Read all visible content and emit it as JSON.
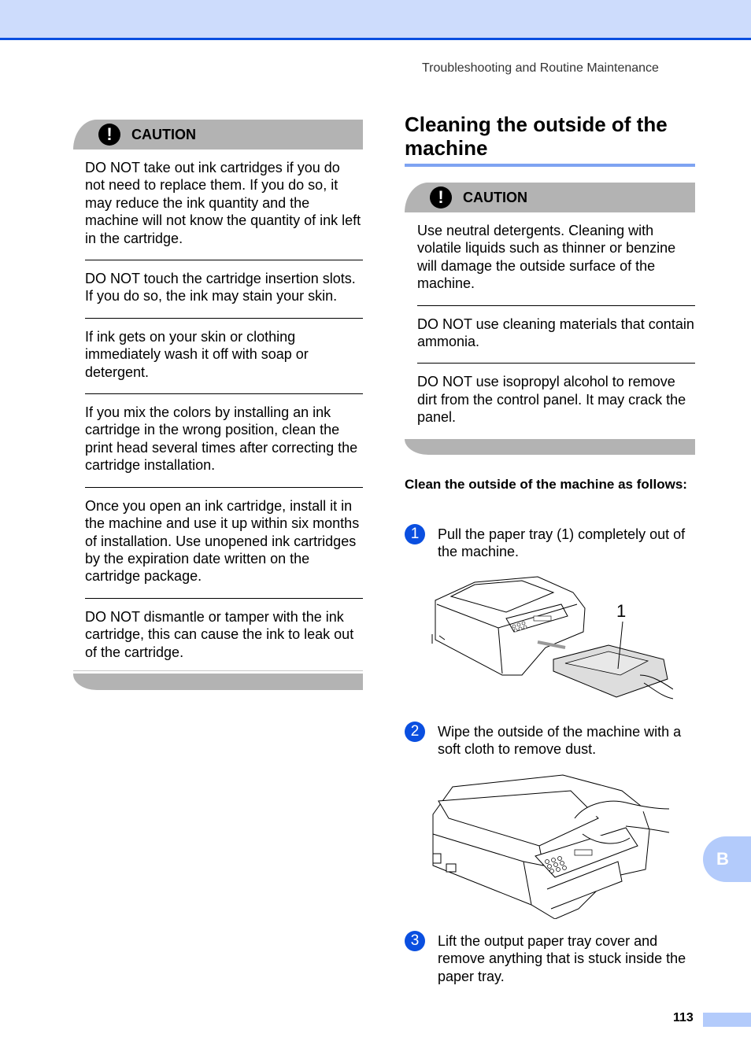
{
  "header": {
    "running_title": "Troubleshooting and Routine Maintenance"
  },
  "left_caution": {
    "label": "CAUTION",
    "icon": "exclamation-icon",
    "items": [
      "DO NOT take out ink cartridges if you do not need to replace them. If you do so, it may reduce the ink quantity and the machine will not know the quantity of ink left in the cartridge.",
      "DO NOT touch the cartridge insertion slots. If you do so, the ink may stain your skin.",
      "If ink gets on your skin or clothing immediately wash it off with soap or detergent.",
      "If you mix the colors by installing an ink cartridge in the wrong position, clean the print head several times after correcting the cartridge installation.",
      "Once you open an ink cartridge, install it in the machine and use it up within six months of installation. Use unopened ink cartridges by the expiration date written on the cartridge package.",
      "DO NOT dismantle or tamper with the ink cartridge, this can cause the ink to leak out of the cartridge."
    ]
  },
  "section": {
    "title": "Cleaning the outside of the machine",
    "caution": {
      "label": "CAUTION",
      "icon": "exclamation-icon",
      "items": [
        "Use neutral detergents. Cleaning with volatile liquids such as thinner or benzine will damage the outside surface of the machine.",
        "DO NOT use cleaning materials that contain ammonia.",
        "DO NOT use isopropyl alcohol to remove dirt from the control panel. It may crack the panel."
      ]
    },
    "subheading": "Clean the outside of the machine as follows:",
    "steps": [
      {
        "number": "1",
        "text": "Pull the paper tray (1) completely out of the machine.",
        "figure_callout": "1"
      },
      {
        "number": "2",
        "text": "Wipe the outside of the machine with a soft cloth to remove dust."
      },
      {
        "number": "3",
        "text": "Lift the output paper tray cover and remove anything that is stuck inside the paper tray."
      }
    ]
  },
  "side_tab": {
    "label": "B"
  },
  "footer": {
    "page_number": "113"
  },
  "colors": {
    "band": "#cddcfc",
    "accent_blue": "#0a4fe0",
    "rule_blue": "#7ea3f2",
    "caution_gray": "#b3b3b3",
    "tab_blue": "#b3cbfb"
  }
}
